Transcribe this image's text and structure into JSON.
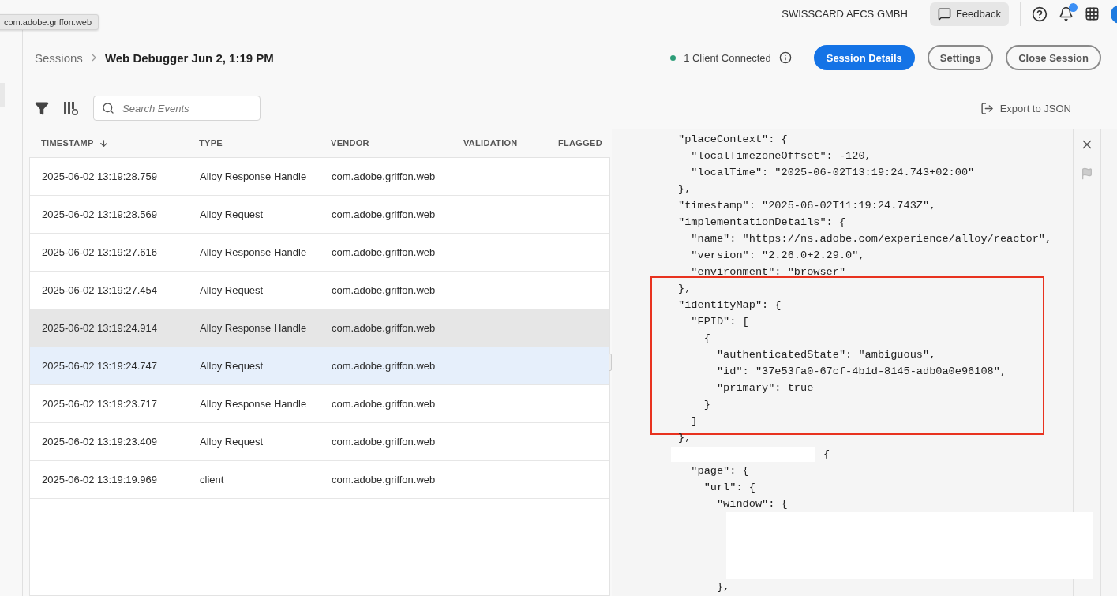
{
  "tooltip": "com.adobe.griffon.web",
  "top_bar": {
    "org": "SWISSCARD AECS GMBH",
    "feedback": "Feedback",
    "has_notification": true
  },
  "breadcrumb": {
    "parent": "Sessions",
    "current": "Web Debugger Jun 2, 1:19 PM"
  },
  "status": {
    "text": "1 Client Connected",
    "connected": true
  },
  "actions": [
    {
      "label": "Session Details",
      "primary": true
    },
    {
      "label": "Settings",
      "primary": false
    },
    {
      "label": "Close Session",
      "primary": false
    }
  ],
  "search": {
    "placeholder": "Search Events"
  },
  "export": "Export to JSON",
  "table": {
    "columns": [
      {
        "label": "TIMESTAMP",
        "sorted": true
      },
      {
        "label": "TYPE",
        "sorted": false
      },
      {
        "label": "VENDOR",
        "sorted": false
      },
      {
        "label": "VALIDATION",
        "sorted": false
      },
      {
        "label": "FLAGGED",
        "sorted": false
      }
    ],
    "rows": [
      {
        "timestamp": "2025-06-02 13:19:28.759",
        "type": "Alloy Response Handle",
        "vendor": "com.adobe.griffon.web",
        "selected": false,
        "hovered": false
      },
      {
        "timestamp": "2025-06-02 13:19:28.569",
        "type": "Alloy Request",
        "vendor": "com.adobe.griffon.web",
        "selected": false,
        "hovered": false
      },
      {
        "timestamp": "2025-06-02 13:19:27.616",
        "type": "Alloy Response Handle",
        "vendor": "com.adobe.griffon.web",
        "selected": false,
        "hovered": false
      },
      {
        "timestamp": "2025-06-02 13:19:27.454",
        "type": "Alloy Request",
        "vendor": "com.adobe.griffon.web",
        "selected": false,
        "hovered": false
      },
      {
        "timestamp": "2025-06-02 13:19:24.914",
        "type": "Alloy Response Handle",
        "vendor": "com.adobe.griffon.web",
        "selected": false,
        "hovered": true
      },
      {
        "timestamp": "2025-06-02 13:19:24.747",
        "type": "Alloy Request",
        "vendor": "com.adobe.griffon.web",
        "selected": true,
        "hovered": false
      },
      {
        "timestamp": "2025-06-02 13:19:23.717",
        "type": "Alloy Response Handle",
        "vendor": "com.adobe.griffon.web",
        "selected": false,
        "hovered": false
      },
      {
        "timestamp": "2025-06-02 13:19:23.409",
        "type": "Alloy Request",
        "vendor": "com.adobe.griffon.web",
        "selected": false,
        "hovered": false
      },
      {
        "timestamp": "2025-06-02 13:19:19.969",
        "type": "client",
        "vendor": "com.adobe.griffon.web",
        "selected": false,
        "hovered": false
      }
    ]
  },
  "code": {
    "sections": [
      {
        "highlighted": false,
        "lines": [
          {
            "kind": "text",
            "text": "\"placeContext\": {"
          },
          {
            "kind": "text",
            "text": "  \"localTimezoneOffset\": -120,"
          },
          {
            "kind": "text",
            "text": "  \"localTime\": \"2025-06-02T13:19:24.743+02:00\""
          },
          {
            "kind": "text",
            "text": "},"
          },
          {
            "kind": "text",
            "text": "\"timestamp\": \"2025-06-02T11:19:24.743Z\","
          },
          {
            "kind": "text",
            "text": "\"implementationDetails\": {"
          },
          {
            "kind": "text",
            "text": "  \"name\": \"https://ns.adobe.com/experience/alloy/reactor\","
          },
          {
            "kind": "text",
            "text": "  \"version\": \"2.26.0+2.29.0\","
          },
          {
            "kind": "text",
            "text": "  \"environment\": \"browser\""
          }
        ]
      },
      {
        "highlighted": true,
        "lines": [
          {
            "kind": "text",
            "text": "},"
          },
          {
            "kind": "text",
            "text": "\"identityMap\": {"
          },
          {
            "kind": "text",
            "text": "  \"FPID\": ["
          },
          {
            "kind": "text",
            "text": "    {"
          },
          {
            "kind": "text",
            "text": "      \"authenticatedState\": \"ambiguous\","
          },
          {
            "kind": "text",
            "text": "      \"id\": \"37e53fa0-67cf-4b1d-8145-adb0a0e96108\","
          },
          {
            "kind": "text",
            "text": "      \"primary\": true"
          },
          {
            "kind": "text",
            "text": "    }"
          },
          {
            "kind": "text",
            "text": "  ]"
          }
        ]
      },
      {
        "highlighted": false,
        "lines": [
          {
            "kind": "text",
            "text": "},"
          },
          {
            "kind": "redacted",
            "text": "{"
          },
          {
            "kind": "text",
            "text": "  \"page\": {"
          },
          {
            "kind": "text",
            "text": "    \"url\": {"
          },
          {
            "kind": "text",
            "text": "      \"window\": {"
          },
          {
            "kind": "redacted-block"
          },
          {
            "kind": "text",
            "text": "      },"
          }
        ]
      }
    ]
  }
}
